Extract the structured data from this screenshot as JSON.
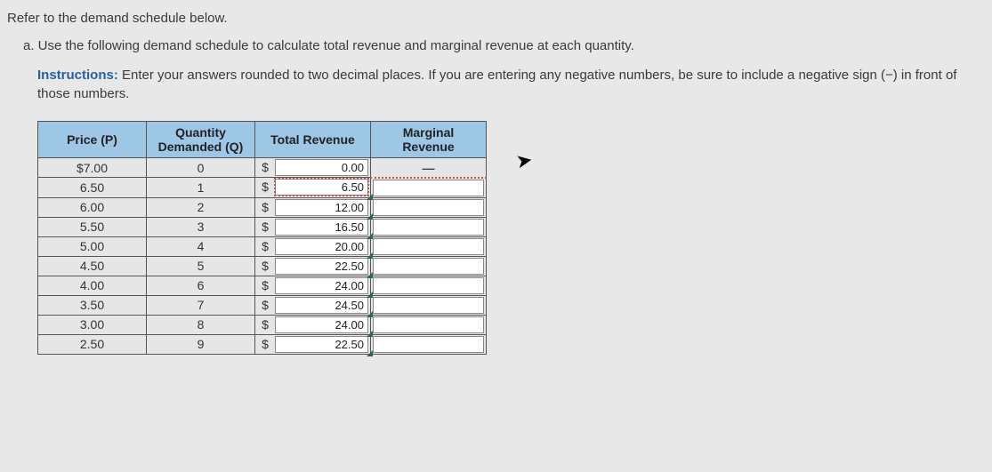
{
  "text": {
    "intro": "Refer to the demand schedule below.",
    "part_a": "a. Use the following demand schedule to calculate total revenue and marginal revenue at each quantity.",
    "instructions_label": "Instructions:",
    "instructions_body": " Enter your answers rounded to two decimal places. If you are entering any negative numbers, be sure to include a negative sign (−) in front of those numbers."
  },
  "headers": {
    "price": "Price (P)",
    "qty_line1": "Quantity",
    "qty_line2": "Demanded (Q)",
    "tr": "Total Revenue",
    "mr": "Marginal Revenue"
  },
  "currency": "$",
  "dash": "—",
  "rows": [
    {
      "price": "$7.00",
      "qty": "0",
      "tr": "0.00",
      "mr_dash": true,
      "selected": false
    },
    {
      "price": "6.50",
      "qty": "1",
      "tr": "6.50",
      "mr_dash": false,
      "selected": true
    },
    {
      "price": "6.00",
      "qty": "2",
      "tr": "12.00",
      "mr_dash": false,
      "selected": false
    },
    {
      "price": "5.50",
      "qty": "3",
      "tr": "16.50",
      "mr_dash": false,
      "selected": false
    },
    {
      "price": "5.00",
      "qty": "4",
      "tr": "20.00",
      "mr_dash": false,
      "selected": false
    },
    {
      "price": "4.50",
      "qty": "5",
      "tr": "22.50",
      "mr_dash": false,
      "selected": false
    },
    {
      "price": "4.00",
      "qty": "6",
      "tr": "24.00",
      "mr_dash": false,
      "selected": false
    },
    {
      "price": "3.50",
      "qty": "7",
      "tr": "24.50",
      "mr_dash": false,
      "selected": false
    },
    {
      "price": "3.00",
      "qty": "8",
      "tr": "24.00",
      "mr_dash": false,
      "selected": false
    },
    {
      "price": "2.50",
      "qty": "9",
      "tr": "22.50",
      "mr_dash": false,
      "selected": false
    }
  ]
}
